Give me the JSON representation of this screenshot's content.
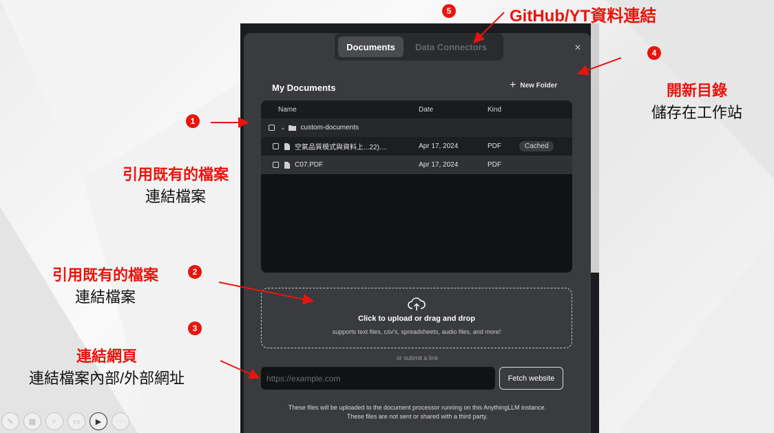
{
  "modal": {
    "tabs": [
      {
        "label": "Documents",
        "active": true
      },
      {
        "label": "Data Connectors",
        "active": false
      }
    ],
    "close_icon": "×",
    "title": "My Documents",
    "new_folder_label": "New Folder",
    "table": {
      "headers": {
        "name": "Name",
        "date": "Date",
        "kind": "Kind"
      },
      "folder": "custom-documents",
      "files": [
        {
          "name": "空氣品質模式與資料上...22)....",
          "date": "Apr 17, 2024",
          "kind": "PDF",
          "badge": "Cached"
        },
        {
          "name": "C07.PDF",
          "date": "Apr 17, 2024",
          "kind": "PDF",
          "badge": ""
        }
      ]
    },
    "upload": {
      "title": "Click to upload or drag and drop",
      "subtitle": "supports text files, csv's, spreadsheets, audio files, and more!"
    },
    "or_submit": "or submit a link",
    "url_placeholder": "https://example.com",
    "fetch_label": "Fetch website",
    "footer_line1": "These files will be uploaded to the document processor running on this AnythingLLM instance.",
    "footer_line2": "These files are not sent or shared with a third party."
  },
  "annotations": {
    "a1": {
      "number": "1"
    },
    "a1_label": {
      "red": "引用既有的檔案",
      "black": "連結檔案"
    },
    "a2": {
      "number": "2",
      "red": "引用既有的檔案",
      "black": "連結檔案"
    },
    "a3": {
      "number": "3",
      "red": "連結網頁",
      "black": "連結檔案內部/外部網址"
    },
    "a4": {
      "number": "4",
      "red": "開新目錄",
      "black": "儲存在工作站"
    },
    "a5": {
      "number": "5",
      "red": "GitHub/YT資料連結"
    }
  },
  "colors": {
    "annotation_red": "#e8150d",
    "modal_bg": "#3a3b3e",
    "table_bg": "#111214"
  }
}
